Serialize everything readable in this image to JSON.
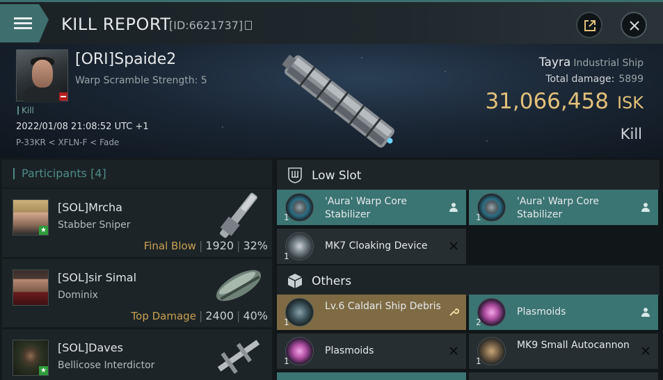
{
  "window": {
    "title": "KILL REPORT",
    "kill_id": "[ID:6621737]"
  },
  "victim": {
    "name": "[ORI]Spaide2",
    "subtitle": "Warp Scramble Strength: 5",
    "tag": "Kill",
    "datetime": "2022/01/08 21:08:52 UTC +1",
    "location": "P-33KR < XFLN-F < Fade"
  },
  "ship": {
    "name": "Tayra",
    "class": "Industrial Ship",
    "total_damage_label": "Total damage:",
    "total_damage": "5899",
    "isk_value": "31,066,458",
    "isk_unit": "ISK",
    "result": "Kill"
  },
  "participants": {
    "label": "Participants",
    "count": "[4]",
    "rows": [
      {
        "name": "[SOL]Mrcha",
        "ship": "Stabber Sniper",
        "tag": "Final Blow",
        "damage": "1920",
        "percent": "32%"
      },
      {
        "name": "[SOL]sir Simal",
        "ship": "Dominix",
        "tag": "Top Damage",
        "damage": "2400",
        "percent": "40%"
      },
      {
        "name": "[SOL]Daves",
        "ship": "Bellicose Interdictor"
      }
    ]
  },
  "sections": {
    "low_slot": "Low Slot",
    "others": "Others"
  },
  "low_slot_items": [
    {
      "qty": "1",
      "name": "'Aura' Warp Core Stabilizer",
      "status": "person-icon"
    },
    {
      "qty": "1",
      "name": "'Aura' Warp Core Stabilizer",
      "status": "person-icon"
    },
    {
      "qty": "1",
      "name": "MK7 Cloaking Device",
      "status": "destroyed-x-icon"
    }
  ],
  "other_items": [
    {
      "qty": "1",
      "name": "Lv.6 Caldari Ship Debris",
      "status": "wrench-icon"
    },
    {
      "qty": "2",
      "name": "Plasmoids",
      "status": "person-icon"
    },
    {
      "qty": "1",
      "name": "Plasmoids",
      "status": "destroyed-x-icon"
    },
    {
      "qty": "1",
      "name": "MK9 Small Autocannon",
      "status": "destroyed-x-icon"
    }
  ],
  "colors": {
    "accent_teal": "#3a7473",
    "isk_gold": "#e3c07a",
    "highlight_tag": "#c9a052",
    "dropped_gold": "#7e6b44"
  }
}
